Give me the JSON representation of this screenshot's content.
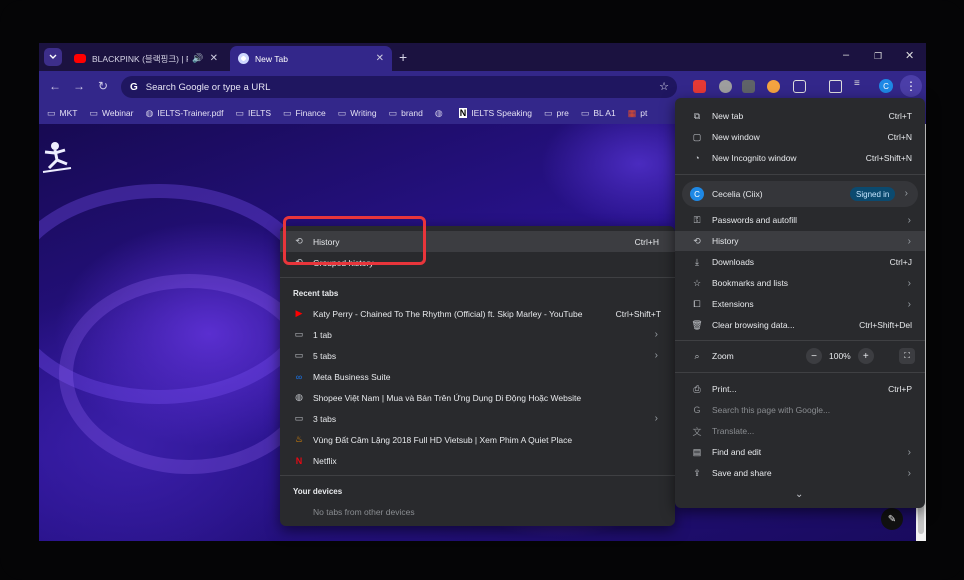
{
  "tabs": [
    {
      "title": "BLACKPINK (블랙핑크) | Pre",
      "state": "inactive",
      "icon": "youtube-icon",
      "audio": true
    },
    {
      "title": "New Tab",
      "state": "active",
      "icon": "chrome-icon"
    }
  ],
  "omnibox": {
    "placeholder": "Search Google or type a URL"
  },
  "bookmarks": [
    {
      "label": "MKT",
      "icon": "folder-icon"
    },
    {
      "label": "Webinar",
      "icon": "folder-icon"
    },
    {
      "label": "IELTS-Trainer.pdf",
      "icon": "globe-icon"
    },
    {
      "label": "IELTS",
      "icon": "folder-icon"
    },
    {
      "label": "Finance",
      "icon": "folder-icon"
    },
    {
      "label": "Writing",
      "icon": "folder-icon"
    },
    {
      "label": "brand",
      "icon": "folder-icon"
    },
    {
      "label": "",
      "icon": "globe-icon"
    },
    {
      "label": "IELTS Speaking",
      "icon": "notion-icon"
    },
    {
      "label": "pre",
      "icon": "folder-icon"
    },
    {
      "label": "BL A1",
      "icon": "folder-icon"
    },
    {
      "label": "pt",
      "icon": "windows-icon"
    }
  ],
  "main_menu": {
    "new_tab": {
      "label": "New tab",
      "shortcut": "Ctrl+T"
    },
    "new_window": {
      "label": "New window",
      "shortcut": "Ctrl+N"
    },
    "new_incognito": {
      "label": "New Incognito window",
      "shortcut": "Ctrl+Shift+N"
    },
    "profile": {
      "initial": "C",
      "name": "Cecelia (Ciix)",
      "badge": "Signed in"
    },
    "passwords": {
      "label": "Passwords and autofill"
    },
    "history": {
      "label": "History"
    },
    "downloads": {
      "label": "Downloads",
      "shortcut": "Ctrl+J"
    },
    "bookmarks": {
      "label": "Bookmarks and lists"
    },
    "extensions": {
      "label": "Extensions"
    },
    "clear_data": {
      "label": "Clear browsing data...",
      "shortcut": "Ctrl+Shift+Del"
    },
    "zoom": {
      "label": "Zoom",
      "minus": "−",
      "value": "100%",
      "plus": "+"
    },
    "print": {
      "label": "Print...",
      "shortcut": "Ctrl+P"
    },
    "search_page": {
      "label": "Search this page with Google..."
    },
    "translate": {
      "label": "Translate..."
    },
    "find_edit": {
      "label": "Find and edit"
    },
    "save_share": {
      "label": "Save and share"
    }
  },
  "history_submenu": {
    "history": {
      "label": "History",
      "shortcut": "Ctrl+H"
    },
    "grouped": {
      "label": "Grouped history"
    },
    "recent_title": "Recent tabs",
    "recent": [
      {
        "label": "Katy Perry - Chained To The Rhythm (Official) ft. Skip Marley - YouTube",
        "shortcut": "Ctrl+Shift+T",
        "icon": "youtube-icon",
        "arrow": false
      },
      {
        "label": "1 tab",
        "shortcut": "",
        "icon": "window-icon",
        "arrow": true
      },
      {
        "label": "5 tabs",
        "shortcut": "",
        "icon": "window-icon",
        "arrow": true
      },
      {
        "label": "Meta Business Suite",
        "shortcut": "",
        "icon": "meta-icon",
        "arrow": false
      },
      {
        "label": "Shopee Việt Nam | Mua và Bán Trên Ứng Dụng Di Động Hoặc Website",
        "shortcut": "",
        "icon": "globe-icon",
        "arrow": false
      },
      {
        "label": "3 tabs",
        "shortcut": "",
        "icon": "window-icon",
        "arrow": true
      },
      {
        "label": "Vùng Đất Câm Lặng 2018 Full HD Vietsub | Xem Phim A Quiet Place",
        "shortcut": "",
        "icon": "flame-icon",
        "arrow": false
      },
      {
        "label": "Netflix",
        "shortcut": "",
        "icon": "netflix-icon",
        "arrow": false
      }
    ],
    "devices_title": "Your devices",
    "devices_empty": "No tabs from other devices"
  },
  "colors": {
    "highlight": "#e8353b",
    "menu_bg": "#292a2d",
    "toolbar": "#33278a"
  }
}
